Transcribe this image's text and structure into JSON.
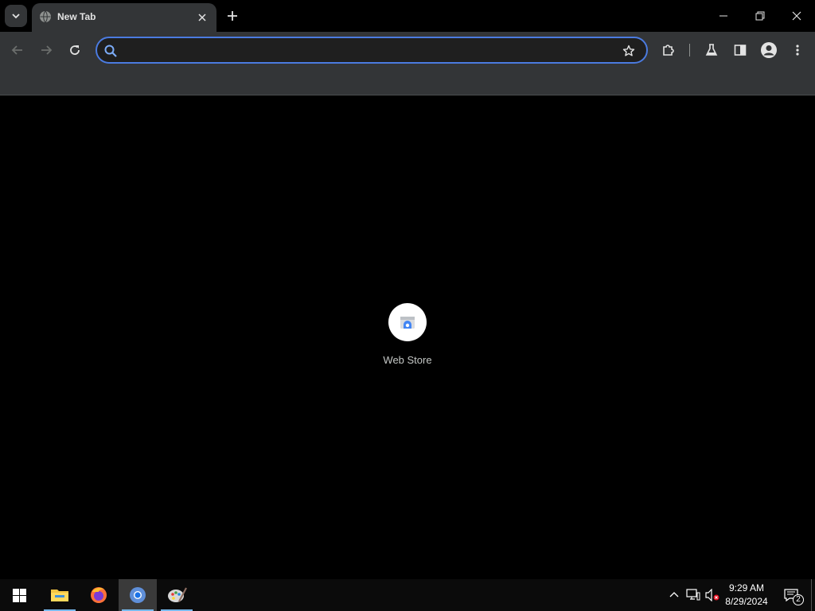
{
  "browser": {
    "tab": {
      "title": "New Tab"
    },
    "omnibox": {
      "value": "",
      "placeholder": ""
    }
  },
  "page": {
    "shortcuts": [
      {
        "label": "Web Store"
      }
    ]
  },
  "taskbar": {
    "apps": [
      "windows-start",
      "file-explorer",
      "firefox",
      "chrome",
      "paint"
    ],
    "clock": {
      "time": "9:29 AM",
      "date": "8/29/2024"
    },
    "notifications_count": "2"
  },
  "colors": {
    "toolbar_bg": "#333537",
    "omnibox_border": "#4b7be0",
    "page_bg": "#000000",
    "taskbar_bg": "#0b0b0b",
    "taskbar_underline": "#76b9ed"
  }
}
